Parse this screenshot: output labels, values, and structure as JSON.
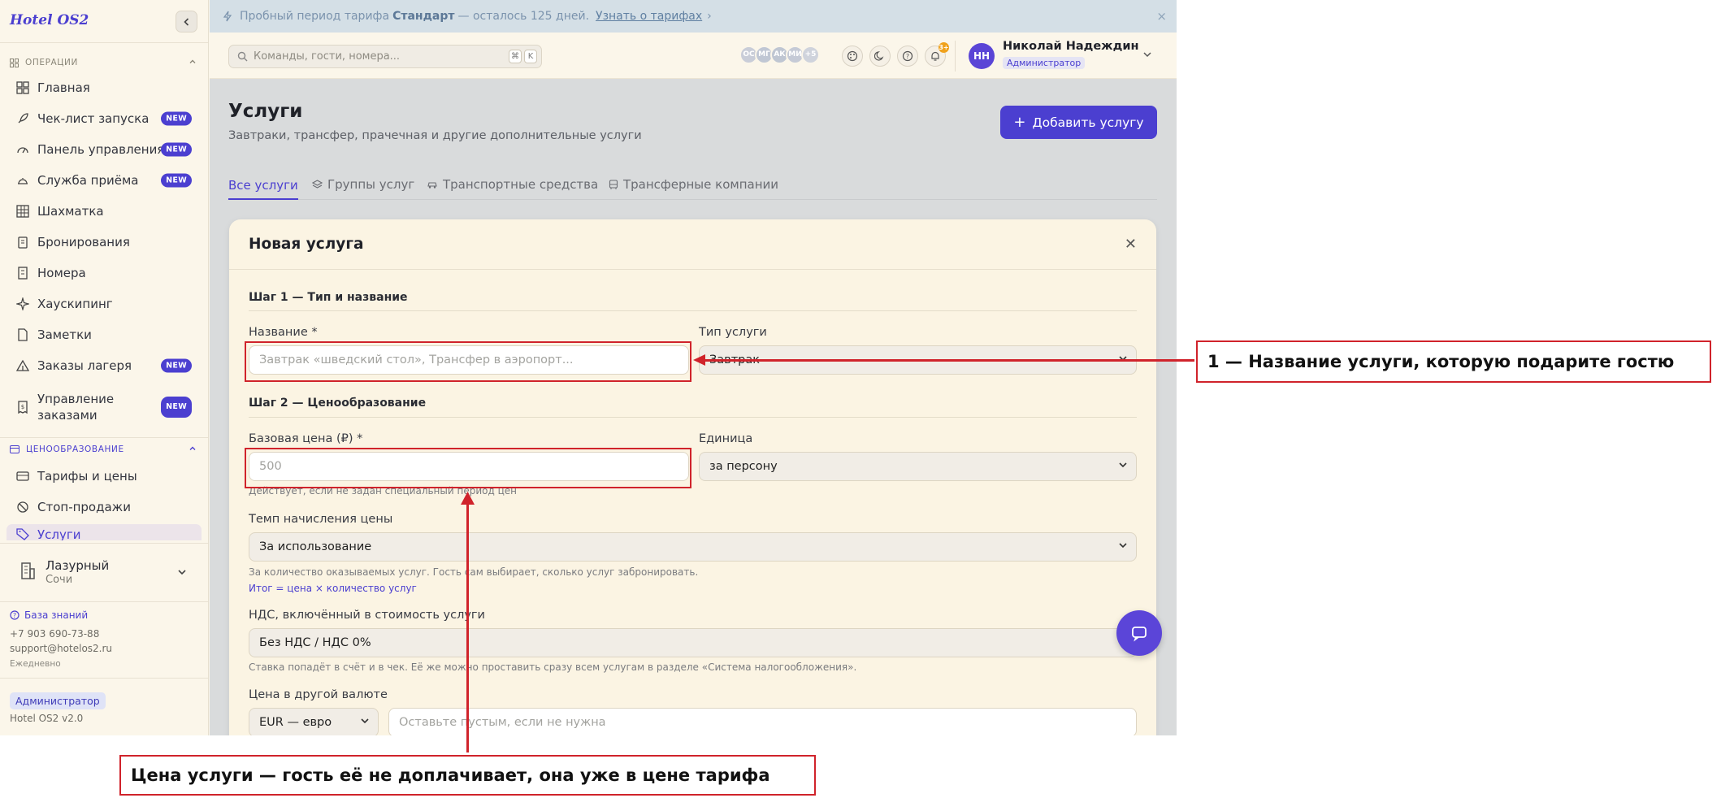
{
  "sidebar": {
    "logo": "Hotel OS2",
    "section_ops": "ОПЕРАЦИИ",
    "section_pricing": "ЦЕНООБРАЗОВАНИЕ",
    "new_badge": "NEW",
    "items_ops": [
      {
        "label": "Главная",
        "icon": "dashboard-icon",
        "new": false
      },
      {
        "label": "Чек-лист запуска",
        "icon": "rocket-icon",
        "new": true
      },
      {
        "label": "Панель управления",
        "icon": "gauge-icon",
        "new": true
      },
      {
        "label": "Служба приёма",
        "icon": "bell-desk-icon",
        "new": true
      },
      {
        "label": "Шахматка",
        "icon": "grid-icon",
        "new": false
      },
      {
        "label": "Бронирования",
        "icon": "clipboard-icon",
        "new": false
      },
      {
        "label": "Номера",
        "icon": "building-icon",
        "new": false
      },
      {
        "label": "Хаускипинг",
        "icon": "sparkle-icon",
        "new": false
      },
      {
        "label": "Заметки",
        "icon": "note-icon",
        "new": false
      },
      {
        "label": "Заказы лагеря",
        "icon": "tent-icon",
        "new": true
      },
      {
        "label": "Управление заказами",
        "icon": "receipt-icon",
        "new": true
      }
    ],
    "items_pricing": [
      {
        "label": "Тарифы и цены",
        "icon": "card-icon"
      },
      {
        "label": "Стоп-продажи",
        "icon": "ban-icon"
      },
      {
        "label": "Услуги",
        "icon": "tag-icon"
      }
    ],
    "hotel": {
      "name": "Лазурный",
      "city": "Сочи"
    },
    "kb_link": "База знаний",
    "phone": "+7 903 690-73-88",
    "email": "support@hotelos2.ru",
    "schedule": "Ежедневно",
    "role": "Администратор",
    "version": "Hotel OS2 v2.0"
  },
  "trial": {
    "prefix": "Пробный период тарифа",
    "plan": "Стандарт",
    "suffix": "— осталось 125 дней.",
    "link": "Узнать о тарифах",
    "link_arrow": "›",
    "close": "×"
  },
  "topbar": {
    "search_placeholder": "Команды, гости, номера...",
    "kbd_cmd": "⌘",
    "kbd_k": "K",
    "avatars": [
      "ОС",
      "МГ",
      "АК",
      "МИ",
      "+5"
    ],
    "notif_count": "3+",
    "user_initials": "НН",
    "user_name": "Николай Надеждин",
    "user_role": "Администратор"
  },
  "page": {
    "title": "Услуги",
    "subtitle": "Завтраки, трансфер, прачечная и другие дополнительные услуги",
    "add_button": "Добавить услугу",
    "tabs": [
      "Все услуги",
      "Группы услуг",
      "Транспортные средства",
      "Трансферные компании"
    ]
  },
  "modal": {
    "title": "Новая услуга",
    "step1": "Шаг 1 — Тип и название",
    "name_label": "Название *",
    "name_placeholder": "Завтрак «шведский стол», Трансфер в аэропорт...",
    "type_label": "Тип услуги",
    "type_value": "Завтрак",
    "step2": "Шаг 2 — Ценообразование",
    "price_label": "Базовая цена (₽) *",
    "price_placeholder": "500",
    "price_hint": "Действует, если не задан специальный период цен",
    "unit_label": "Единица",
    "unit_value": "за персону",
    "accrual_label": "Темп начисления цены",
    "accrual_value": "За использование",
    "accrual_hint": "За количество оказываемых услуг. Гость сам выбирает, сколько услуг забронировать.",
    "accrual_formula": "Итог = цена × количество услуг",
    "vat_label": "НДС, включённый в стоимость услуги",
    "vat_value": "Без НДС / НДС 0%",
    "vat_hint": "Ставка попадёт в счёт и в чек. Её же можно проставить сразу всем услугам в разделе «Система налогообложения».",
    "currency_label": "Цена в другой валюте",
    "currency_value": "EUR — евро",
    "currency_placeholder": "Оставьте пустым, если не нужна"
  },
  "annotations": {
    "callout_1": "1 — Название услуги, которую подарите гостю",
    "callout_2": "Цена услуги — гость её не доплачивает, она уже в цене тарифа",
    "color": "#d0232b"
  },
  "colors": {
    "accent": "#4b3fd0",
    "sidebar_bg": "#fbf6ea",
    "overlay": "#d9dbdc"
  }
}
